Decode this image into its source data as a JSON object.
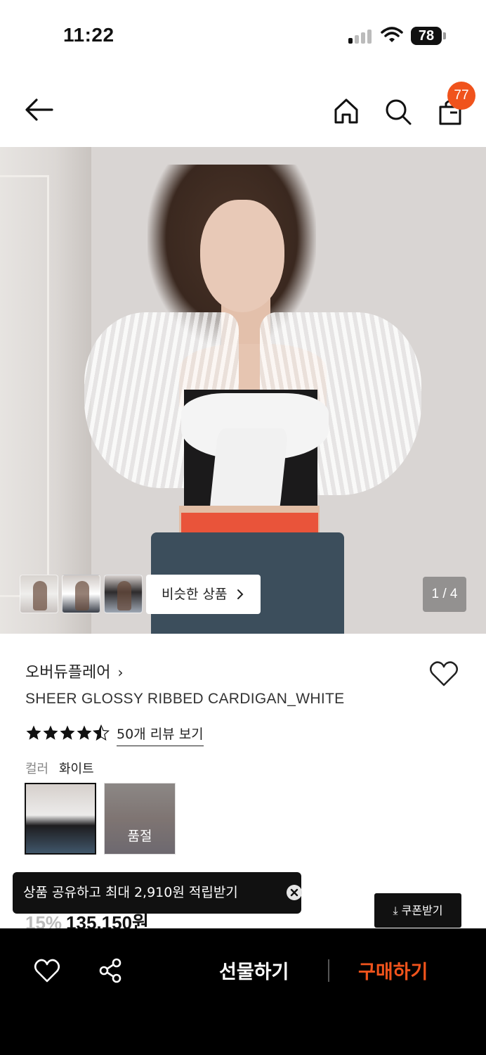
{
  "status_bar": {
    "time": "11:22",
    "battery": "78"
  },
  "header": {
    "cart_count": "77",
    "icons": [
      "back-icon",
      "home-icon",
      "search-icon",
      "cart-icon"
    ]
  },
  "gallery": {
    "similar_label": "비슷한 상품",
    "page_indicator": "1 / 4",
    "thumbnails": 3
  },
  "product": {
    "brand": "오버듀플레어",
    "name": "SHEER GLOSSY RIBBED CARDIGAN_WHITE",
    "rating": 4.5,
    "review_link": "50개 리뷰 보기",
    "color_label": "컬러",
    "color_value": "화이트",
    "sold_out_label": "품절",
    "discount": "15%",
    "price": "135,150원"
  },
  "share_tooltip": {
    "text": "상품 공유하고 최대 2,910원 적립받기"
  },
  "coupon_button": "쿠폰받기",
  "bottom_bar": {
    "gift_label": "선물하기",
    "buy_label": "구매하기"
  },
  "colors": {
    "accent": "#f0531c",
    "bar_bg": "#000000"
  }
}
